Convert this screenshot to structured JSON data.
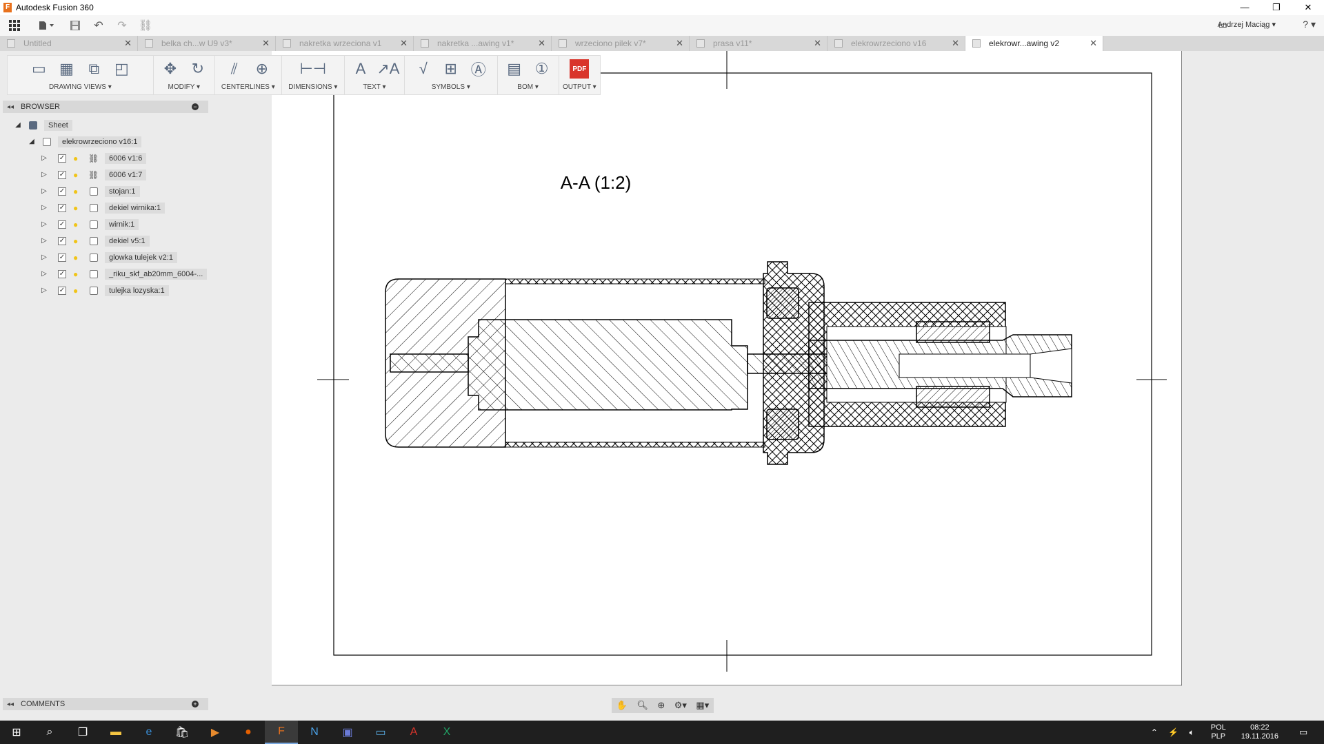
{
  "window": {
    "title": "Autodesk Fusion 360",
    "controls": [
      "—",
      "❐",
      "✕"
    ]
  },
  "app_toolbar": {
    "user_name": "Andrzej Maciąg ▾",
    "help": "? ▾"
  },
  "tabs": [
    {
      "label": "Untitled",
      "active": false
    },
    {
      "label": "belka ch...w U9 v3*",
      "active": false
    },
    {
      "label": "nakretka wrzeciona v1",
      "active": false
    },
    {
      "label": "nakretka ...awing v1*",
      "active": false
    },
    {
      "label": "wrzeciono pilek v7*",
      "active": false
    },
    {
      "label": "prasa v11*",
      "active": false
    },
    {
      "label": "elekrowrzeciono v16",
      "active": false
    },
    {
      "label": "elekrowr...awing v2",
      "active": true
    }
  ],
  "ribbon": {
    "groups": [
      {
        "label": "DRAWING VIEWS ▾"
      },
      {
        "label": "MODIFY ▾"
      },
      {
        "label": "CENTERLINES ▾"
      },
      {
        "label": "DIMENSIONS ▾"
      },
      {
        "label": "TEXT ▾"
      },
      {
        "label": "SYMBOLS ▾"
      },
      {
        "label": "BOM ▾"
      },
      {
        "label": "OUTPUT ▾"
      }
    ],
    "pdf_label": "PDF"
  },
  "browser": {
    "title": "BROWSER",
    "sheet_label": "Sheet",
    "root_label": "elekrowrzeciono v16:1",
    "items": [
      {
        "label": "6006 v1:6",
        "linked": true
      },
      {
        "label": "6006 v1:7",
        "linked": true
      },
      {
        "label": "stojan:1",
        "linked": false
      },
      {
        "label": "dekiel wirnika:1",
        "linked": false
      },
      {
        "label": "wirnik:1",
        "linked": false
      },
      {
        "label": "dekiel v5:1",
        "linked": false
      },
      {
        "label": "glowka tulejek v2:1",
        "linked": false
      },
      {
        "label": "_riku_skf_ab20mm_6004-...",
        "linked": false
      },
      {
        "label": "tulejka lozyska:1",
        "linked": false
      }
    ]
  },
  "drawing": {
    "view_title": "A-A (1:2)"
  },
  "comments": {
    "title": "COMMENTS"
  },
  "taskbar": {
    "lang_top": "POL",
    "lang_bottom": "PLP",
    "time": "08:22",
    "date": "19.11.2016"
  }
}
